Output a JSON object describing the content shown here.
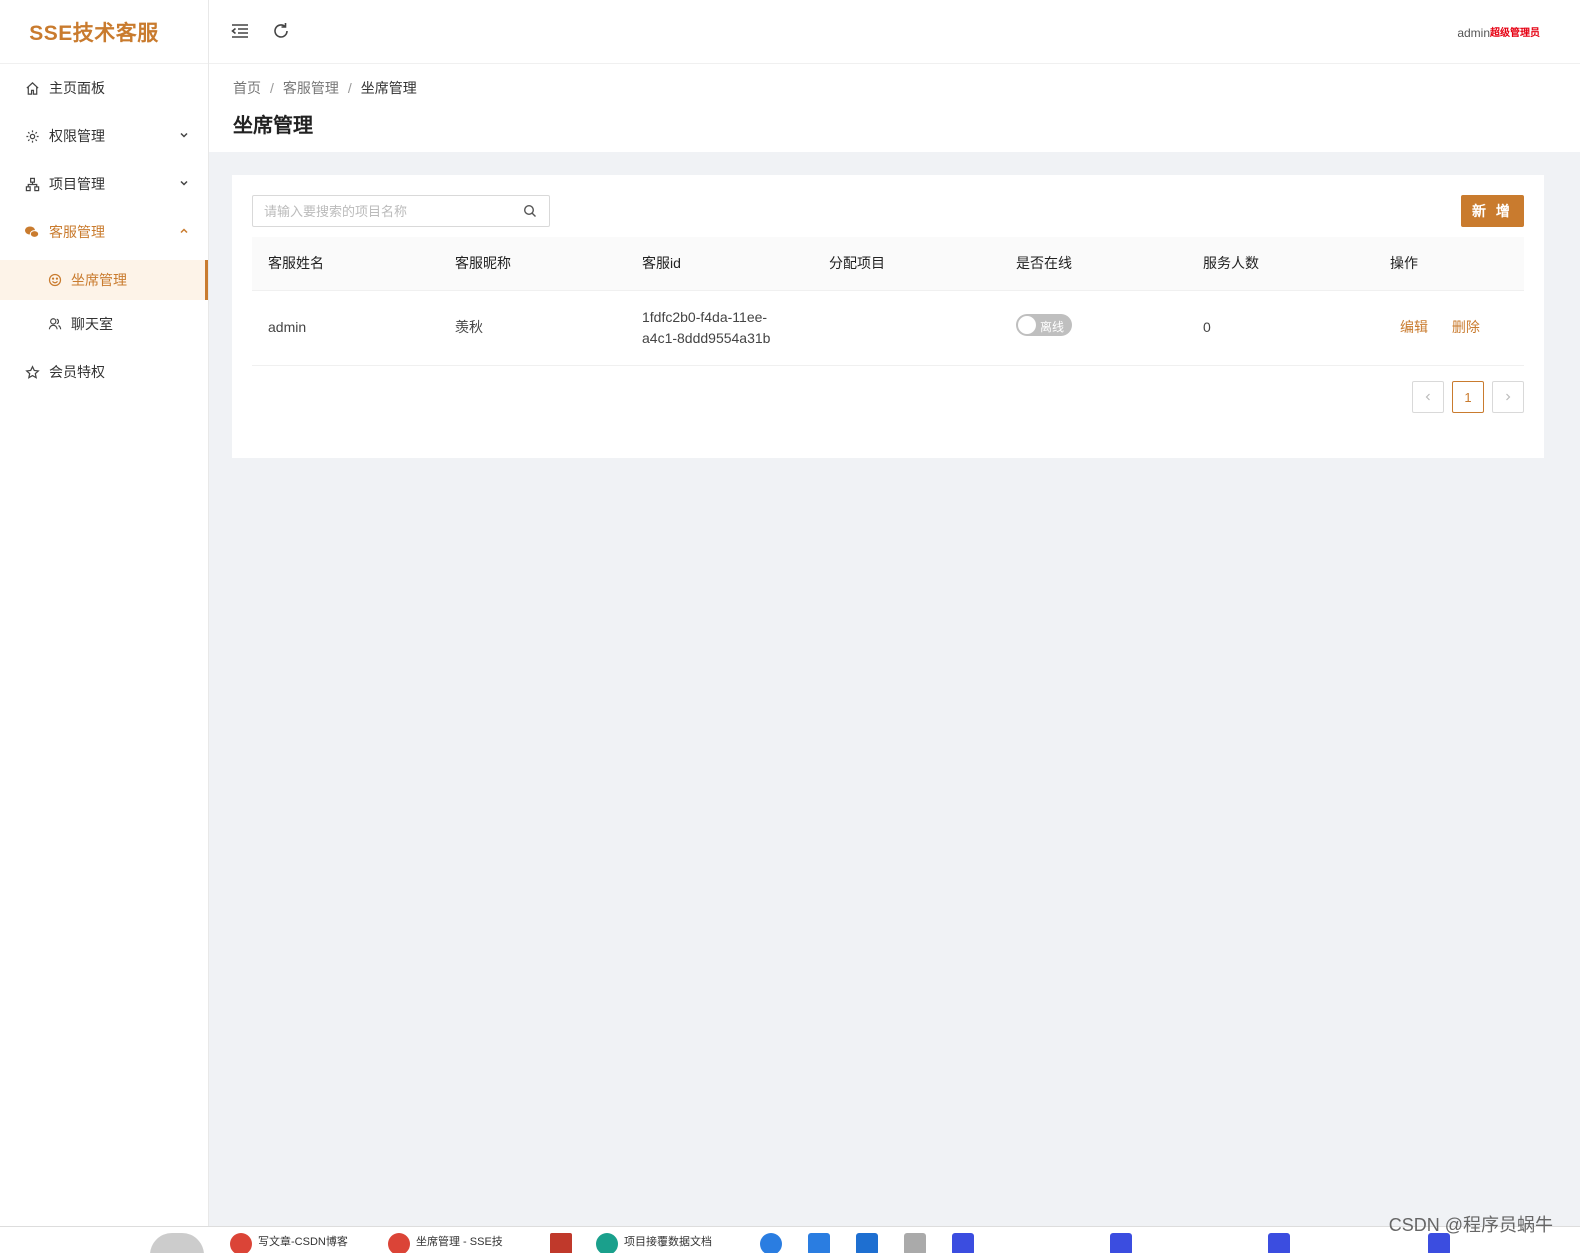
{
  "app": {
    "logo": "SSE技术客服"
  },
  "sidebar": {
    "items": [
      {
        "label": "主页面板"
      },
      {
        "label": "权限管理"
      },
      {
        "label": "项目管理"
      },
      {
        "label": "客服管理"
      }
    ],
    "sub_items": [
      {
        "label": "坐席管理"
      },
      {
        "label": "聊天室"
      }
    ],
    "last_item": {
      "label": "会员特权"
    }
  },
  "header": {
    "user": "admin",
    "role": "超级管理员"
  },
  "breadcrumb": {
    "home": "首页",
    "parent": "客服管理",
    "current": "坐席管理"
  },
  "page": {
    "title": "坐席管理"
  },
  "search": {
    "placeholder": "请输入要搜索的项目名称"
  },
  "toolbar": {
    "add_label": "新 增"
  },
  "table": {
    "columns": [
      "客服姓名",
      "客服昵称",
      "客服id",
      "分配项目",
      "是否在线",
      "服务人数",
      "操作"
    ],
    "rows": [
      {
        "name": "admin",
        "nickname": "羡秋",
        "id_line1": "1fdfc2b0-f4da-11ee-",
        "id_line2": "a4c1-8ddd9554a31b",
        "project": "",
        "online_label": "离线",
        "served": "0",
        "edit": "编辑",
        "delete": "删除"
      }
    ]
  },
  "pagination": {
    "prev": "<",
    "page": "1",
    "next": ">"
  },
  "taskbar": {
    "items": [
      "写文章-CSDN博客",
      "坐席管理 - SSE技",
      "项目接覆数据文档"
    ]
  },
  "watermark": "CSDN @程序员蜗牛",
  "colors": {
    "accent": "#c97b2e",
    "role_red": "#e60012"
  }
}
